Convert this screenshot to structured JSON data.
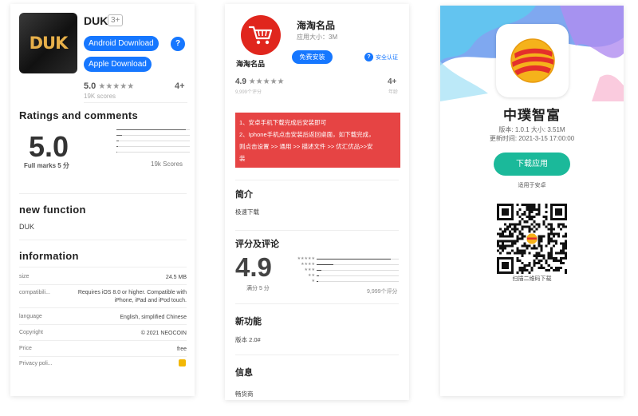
{
  "card1": {
    "app_icon_text": "DUK",
    "app_name": "DUK",
    "age_badge": "3+",
    "android_button": "Android Download",
    "apple_button": "Apple Download",
    "help_button": "?",
    "rating_value": "5.0",
    "rating_stars": "★★★★★",
    "scores_small": "19K scores",
    "age_right": "4+",
    "ratings_heading": "Ratings and comments",
    "big_score": "5.0",
    "full_marks": "Full marks 5 分",
    "score_count": "19k Scores",
    "rating_distribution": [
      0.95,
      0.08,
      0.03,
      0.02,
      0.01
    ],
    "new_function_heading": "new function",
    "new_function_text": "DUK",
    "information_heading": "information",
    "info_rows": [
      {
        "label": "size",
        "value": "24.5 MB"
      },
      {
        "label": "compatibili...",
        "value": "Requires iOS 8.0 or higher. Compatible with iPhone, iPad and iPod touch."
      },
      {
        "label": "language",
        "value": "English, simplified Chinese"
      },
      {
        "label": "Copyright",
        "value": "© 2021 NEOCOIN"
      },
      {
        "label": "Price",
        "value": "free"
      },
      {
        "label": "Privacy poli...",
        "value": ""
      }
    ],
    "privacy_icon": "hand-icon"
  },
  "card2": {
    "logo_name": "海淘名品",
    "app_name": "海淘名品",
    "app_size": "应用大小：3M",
    "install_button": "免费安装",
    "verify_label": "安全认证",
    "rating_value": "4.9",
    "rating_stars": "★★★★★",
    "rating_sub": "9,999个评分",
    "age": "4+",
    "age_sub": "年龄",
    "notice_lines": [
      "1、安卓手机下载完成后安装即可",
      "2、Iphone手机点击安装后返回桌面，如下载完成，",
      "则点击设置 >> 通用 >> 描述文件 >> 优汇优品>>安",
      "装"
    ],
    "intro_heading": "简介",
    "intro_text": "极速下载",
    "ratings_heading": "评分及评论",
    "big_score": "4.9",
    "full_marks": "满分 5 分",
    "score_count": "9,999个评分",
    "rating_distribution": [
      0.9,
      0.2,
      0.06,
      0.03,
      0.02
    ],
    "new_function_heading": "新功能",
    "version_text": "版本 2.0#",
    "info_heading": "信息",
    "info_text": "畅货商"
  },
  "card3": {
    "app_name": "中璞智富",
    "version_size": "版本: 1.0.1  大小: 3.51M",
    "update_time": "更新时间: 2021-3-15 17:00:00",
    "download_button": "下载应用",
    "suitable_for": "适用于安卓",
    "scan_text": "扫描二维码下载",
    "accent_color": "#1bb99a"
  }
}
